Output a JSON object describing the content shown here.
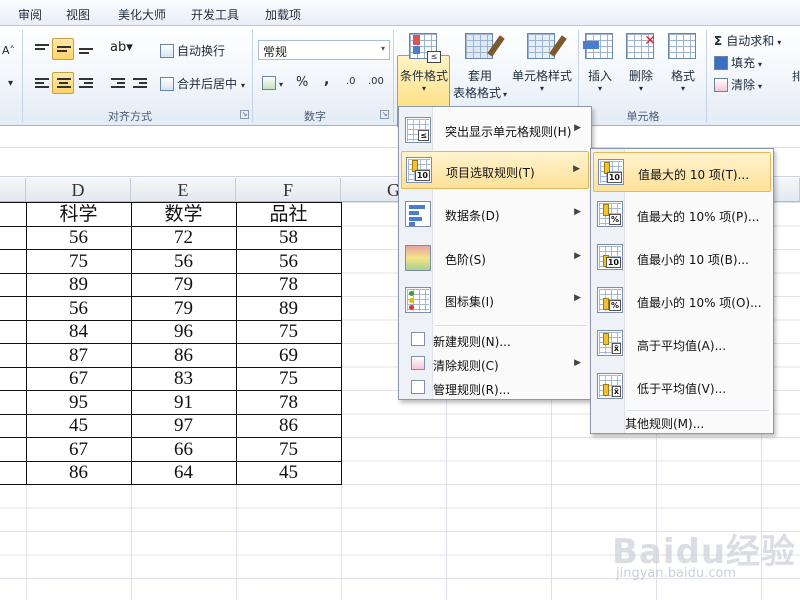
{
  "menubar": {
    "tabs": [
      "审阅",
      "视图",
      "美化大师",
      "开发工具",
      "加载项"
    ]
  },
  "ribbon": {
    "wrap_text": "自动换行",
    "merge_center": "合并后居中",
    "number_format": "常规",
    "percent_symbol": "%",
    "comma_symbol": ",",
    "conditional_format": "条件格式",
    "format_as_table_line1": "套用",
    "format_as_table_line2": "表格格式",
    "cell_styles": "单元格样式",
    "insert": "插入",
    "delete": "删除",
    "format": "格式",
    "autosum": "自动求和",
    "fill": "填充",
    "clear": "清除",
    "sigma_symbol": "Σ",
    "groups": {
      "alignment": "对齐方式",
      "number": "数字",
      "cells": "单元格"
    }
  },
  "sheet": {
    "columns": [
      "D",
      "E",
      "F",
      "G"
    ],
    "table_header": [
      "科学",
      "数学",
      "品社"
    ],
    "rows": [
      [
        "56",
        "72",
        "58"
      ],
      [
        "75",
        "56",
        "56"
      ],
      [
        "89",
        "79",
        "78"
      ],
      [
        "56",
        "79",
        "89"
      ],
      [
        "84",
        "96",
        "75"
      ],
      [
        "87",
        "86",
        "69"
      ],
      [
        "67",
        "83",
        "75"
      ],
      [
        "95",
        "91",
        "78"
      ],
      [
        "45",
        "97",
        "86"
      ],
      [
        "67",
        "66",
        "75"
      ],
      [
        "86",
        "64",
        "45"
      ]
    ]
  },
  "cf_menu": {
    "items": [
      "突出显示单元格规则(H)",
      "项目选取规则(T)",
      "数据条(D)",
      "色阶(S)",
      "图标集(I)",
      "新建规则(N)...",
      "清除规则(C)",
      "管理规则(R)..."
    ]
  },
  "submenu": {
    "items": [
      "值最大的 10 项(T)...",
      "值最大的 10% 项(P)...",
      "值最小的 10 项(B)...",
      "值最小的 10% 项(O)...",
      "高于平均值(A)...",
      "低于平均值(V)..."
    ],
    "more_rules": "其他规则(M)...",
    "tags": [
      "10",
      "%",
      "10",
      "%",
      "x̄",
      "x̄"
    ]
  },
  "watermark": {
    "brand": "Baidu经验",
    "url": "jingyan.baidu.com"
  },
  "colors": {
    "highlight": "#ffe199",
    "accent_border": "#c39a3a",
    "ribbon_bg": "#e3ebf5"
  }
}
